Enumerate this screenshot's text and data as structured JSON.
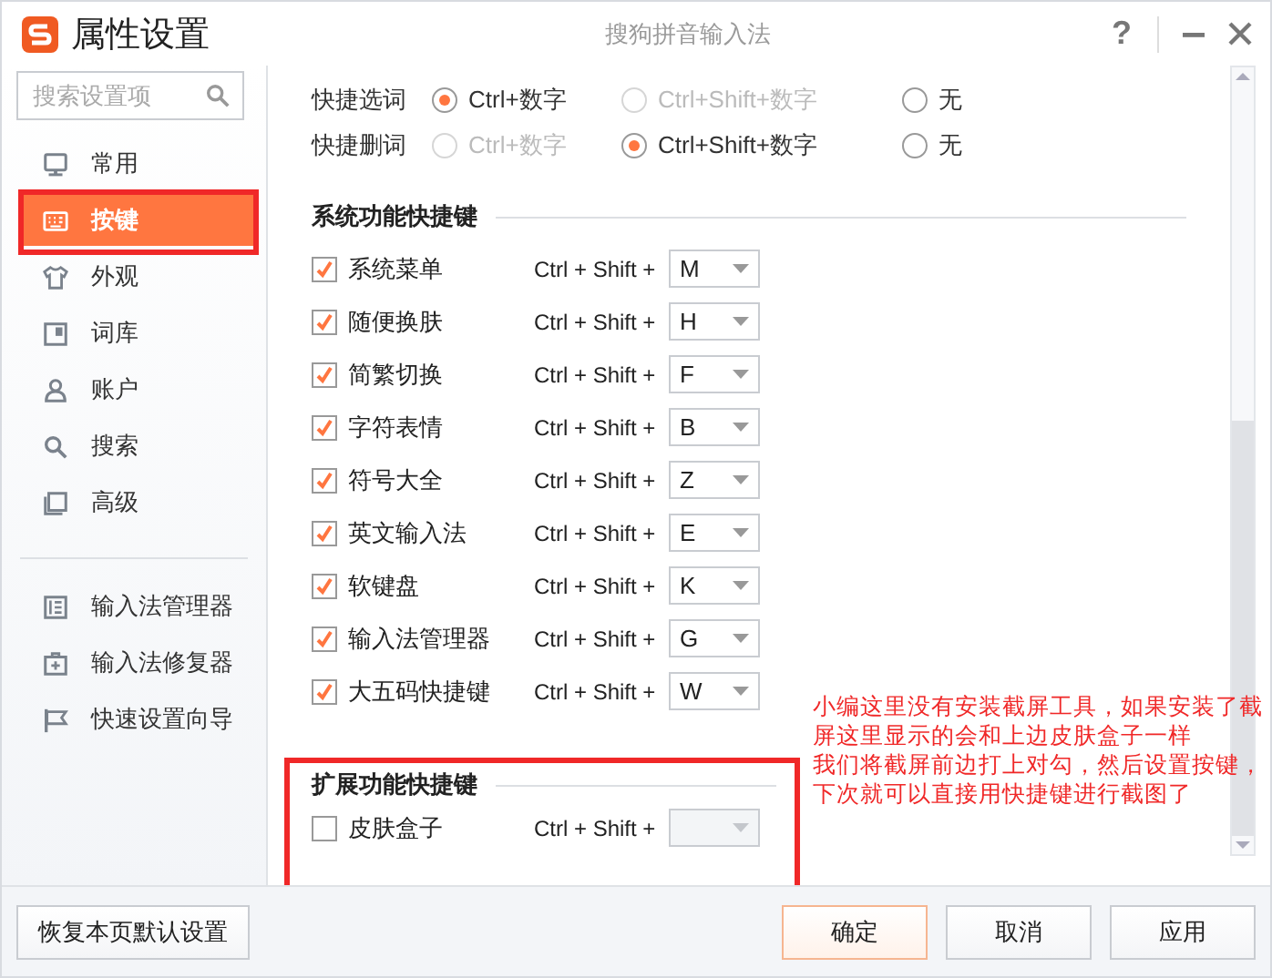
{
  "window": {
    "title": "属性设置",
    "app_name": "搜狗拼音输入法",
    "controls": [
      "?"
    ]
  },
  "sidebar": {
    "search": {
      "placeholder": "搜索设置项"
    },
    "items": [
      {
        "label": "常用",
        "selected": false
      },
      {
        "label": "按键",
        "selected": true
      },
      {
        "label": "外观",
        "selected": false
      },
      {
        "label": "词库",
        "selected": false
      },
      {
        "label": "账户",
        "selected": false
      },
      {
        "label": "搜索",
        "selected": false
      },
      {
        "label": "高级",
        "selected": false
      }
    ],
    "tools": [
      {
        "label": "输入法管理器"
      },
      {
        "label": "输入法修复器"
      },
      {
        "label": "快速设置向导"
      }
    ]
  },
  "quick_rows": [
    {
      "label": "快捷选词",
      "options": [
        {
          "label": "Ctrl+数字",
          "selected": true,
          "disabled": false
        },
        {
          "label": "Ctrl+Shift+数字",
          "selected": false,
          "disabled": true
        },
        {
          "label": "无",
          "selected": false,
          "disabled": false
        }
      ]
    },
    {
      "label": "快捷删词",
      "options": [
        {
          "label": "Ctrl+数字",
          "selected": false,
          "disabled": true
        },
        {
          "label": "Ctrl+Shift+数字",
          "selected": true,
          "disabled": false
        },
        {
          "label": "无",
          "selected": false,
          "disabled": false
        }
      ]
    }
  ],
  "sections": [
    {
      "title": "系统功能快捷键",
      "highlighted": false,
      "items": [
        {
          "label": "系统菜单",
          "checked": true,
          "modifier": "Ctrl + Shift +",
          "key": "M",
          "disabled": false
        },
        {
          "label": "随便换肤",
          "checked": true,
          "modifier": "Ctrl + Shift +",
          "key": "H",
          "disabled": false
        },
        {
          "label": "简繁切换",
          "checked": true,
          "modifier": "Ctrl + Shift +",
          "key": "F",
          "disabled": false
        },
        {
          "label": "字符表情",
          "checked": true,
          "modifier": "Ctrl + Shift +",
          "key": "B",
          "disabled": false
        },
        {
          "label": "符号大全",
          "checked": true,
          "modifier": "Ctrl + Shift +",
          "key": "Z",
          "disabled": false
        },
        {
          "label": "英文输入法",
          "checked": true,
          "modifier": "Ctrl + Shift +",
          "key": "E",
          "disabled": false
        },
        {
          "label": "软键盘",
          "checked": true,
          "modifier": "Ctrl + Shift +",
          "key": "K",
          "disabled": false
        },
        {
          "label": "输入法管理器",
          "checked": true,
          "modifier": "Ctrl + Shift +",
          "key": "G",
          "disabled": false
        },
        {
          "label": "大五码快捷键",
          "checked": true,
          "modifier": "Ctrl + Shift +",
          "key": "W",
          "disabled": false
        }
      ]
    },
    {
      "title": "扩展功能快捷键",
      "highlighted": true,
      "items": [
        {
          "label": "皮肤盒子",
          "checked": false,
          "modifier": "Ctrl + Shift +",
          "disabled": true
        }
      ]
    }
  ],
  "annotation": {
    "lines": [
      "小编这里没有安装截屏工具，如果安装了截",
      "屏这里显示的会和上边皮肤盒子一样",
      "我们将截屏前边打上对勾，然后设置按键，",
      "下次就可以直接用快捷键进行截图了"
    ]
  },
  "footer": {
    "reset": "恢复本页默认设置",
    "buttons": [
      {
        "label": "确定",
        "kind": "primary"
      },
      {
        "label": "取消",
        "kind": "normal"
      },
      {
        "label": "应用",
        "kind": "normal"
      }
    ]
  }
}
